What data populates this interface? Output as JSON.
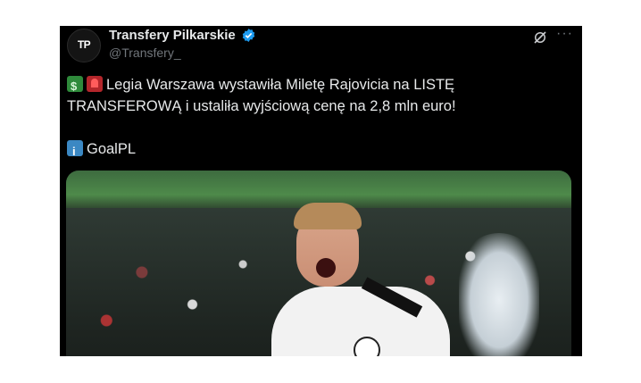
{
  "tweet": {
    "author_name": "Transfery Pilkarskie",
    "handle": "@Transfery_",
    "avatar_text": "TP",
    "text_line1": "Legia Warszawa wystawiła Miletę Rajovicia na LISTĘ",
    "text_line2": "TRANSFEROWĄ i ustaliła wyjściową cenę na 2,8 mln euro!",
    "source": "GoalPL",
    "more_label": "···",
    "icons": [
      "money-with-wings-icon",
      "siren-icon",
      "info-icon",
      "verified-badge-icon",
      "grok-icon",
      "more-icon"
    ],
    "colors": {
      "background": "#000000",
      "text": "#e7e9ea",
      "muted": "#71767b",
      "verified": "#1d9bf0"
    }
  }
}
